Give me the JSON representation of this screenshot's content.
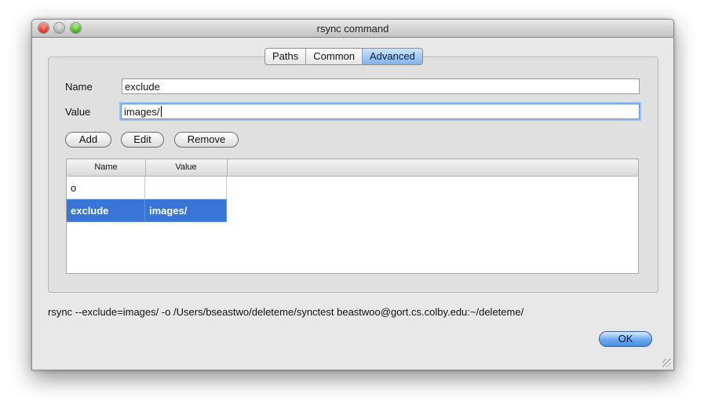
{
  "window": {
    "title": "rsync command"
  },
  "tabs": [
    {
      "label": "Paths",
      "active": false
    },
    {
      "label": "Common",
      "active": false
    },
    {
      "label": "Advanced",
      "active": true
    }
  ],
  "form": {
    "name_label": "Name",
    "name_value": "exclude",
    "value_label": "Value",
    "value_value": "images/"
  },
  "buttons": {
    "add": "Add",
    "edit": "Edit",
    "remove": "Remove",
    "ok": "OK"
  },
  "table": {
    "columns": [
      "Name",
      "Value"
    ],
    "rows": [
      {
        "name": "o",
        "value": "",
        "selected": false
      },
      {
        "name": "exclude",
        "value": "images/",
        "selected": true
      }
    ]
  },
  "command_line": "rsync --exclude=images/ -o /Users/bseastwo/deleteme/synctest beastwoo@gort.cs.colby.edu:~/deleteme/",
  "colors": {
    "selection": "#3875d7",
    "accent": "#6aa8ef"
  }
}
